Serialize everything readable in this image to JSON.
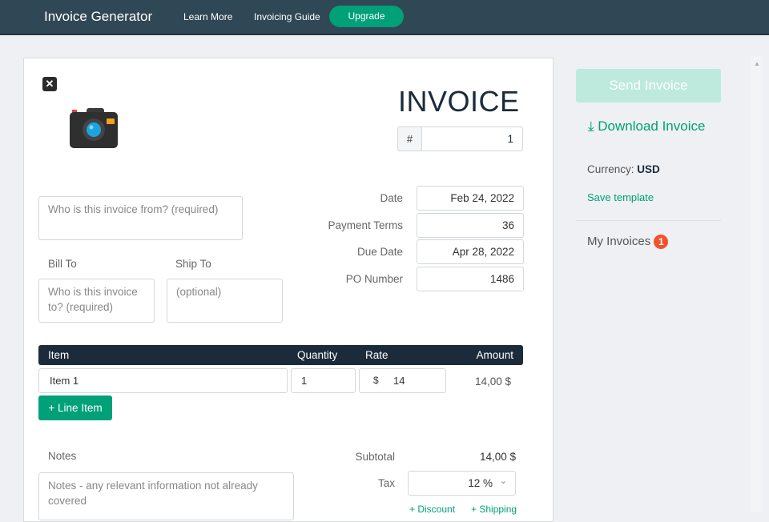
{
  "nav": {
    "brand": "Invoice Generator",
    "learn_more": "Learn More",
    "guide": "Invoicing Guide",
    "upgrade": "Upgrade"
  },
  "invoice": {
    "title": "INVOICE",
    "number_prefix": "#",
    "number": "1",
    "from_placeholder": "Who is this invoice from? (required)",
    "bill_to_label": "Bill To",
    "ship_to_label": "Ship To",
    "bill_to_placeholder": "Who is this invoice to? (required)",
    "ship_to_placeholder": "(optional)",
    "meta": [
      {
        "label": "Date",
        "value": "Feb 24, 2022"
      },
      {
        "label": "Payment Terms",
        "value": "36"
      },
      {
        "label": "Due Date",
        "value": "Apr 28, 2022"
      },
      {
        "label": "PO Number",
        "value": "1486"
      }
    ],
    "table": {
      "headers": {
        "item": "Item",
        "quantity": "Quantity",
        "rate": "Rate",
        "amount": "Amount"
      },
      "rows": [
        {
          "item": "Item 1",
          "quantity": "1",
          "currency": "$",
          "rate": "14",
          "amount": "14,00 $"
        }
      ]
    },
    "add_line": "+ Line Item",
    "notes_label": "Notes",
    "notes_placeholder": "Notes - any relevant information not already covered",
    "subtotal_label": "Subtotal",
    "subtotal": "14,00 $",
    "tax_label": "Tax",
    "tax": "12 %",
    "discount": "+ Discount",
    "shipping": "+ Shipping"
  },
  "sidebar": {
    "send": "Send Invoice",
    "download": "Download Invoice",
    "currency_label": "Currency:",
    "currency": "USD",
    "save_template": "Save template",
    "my_invoices": "My Invoices",
    "my_invoices_count": "1"
  }
}
